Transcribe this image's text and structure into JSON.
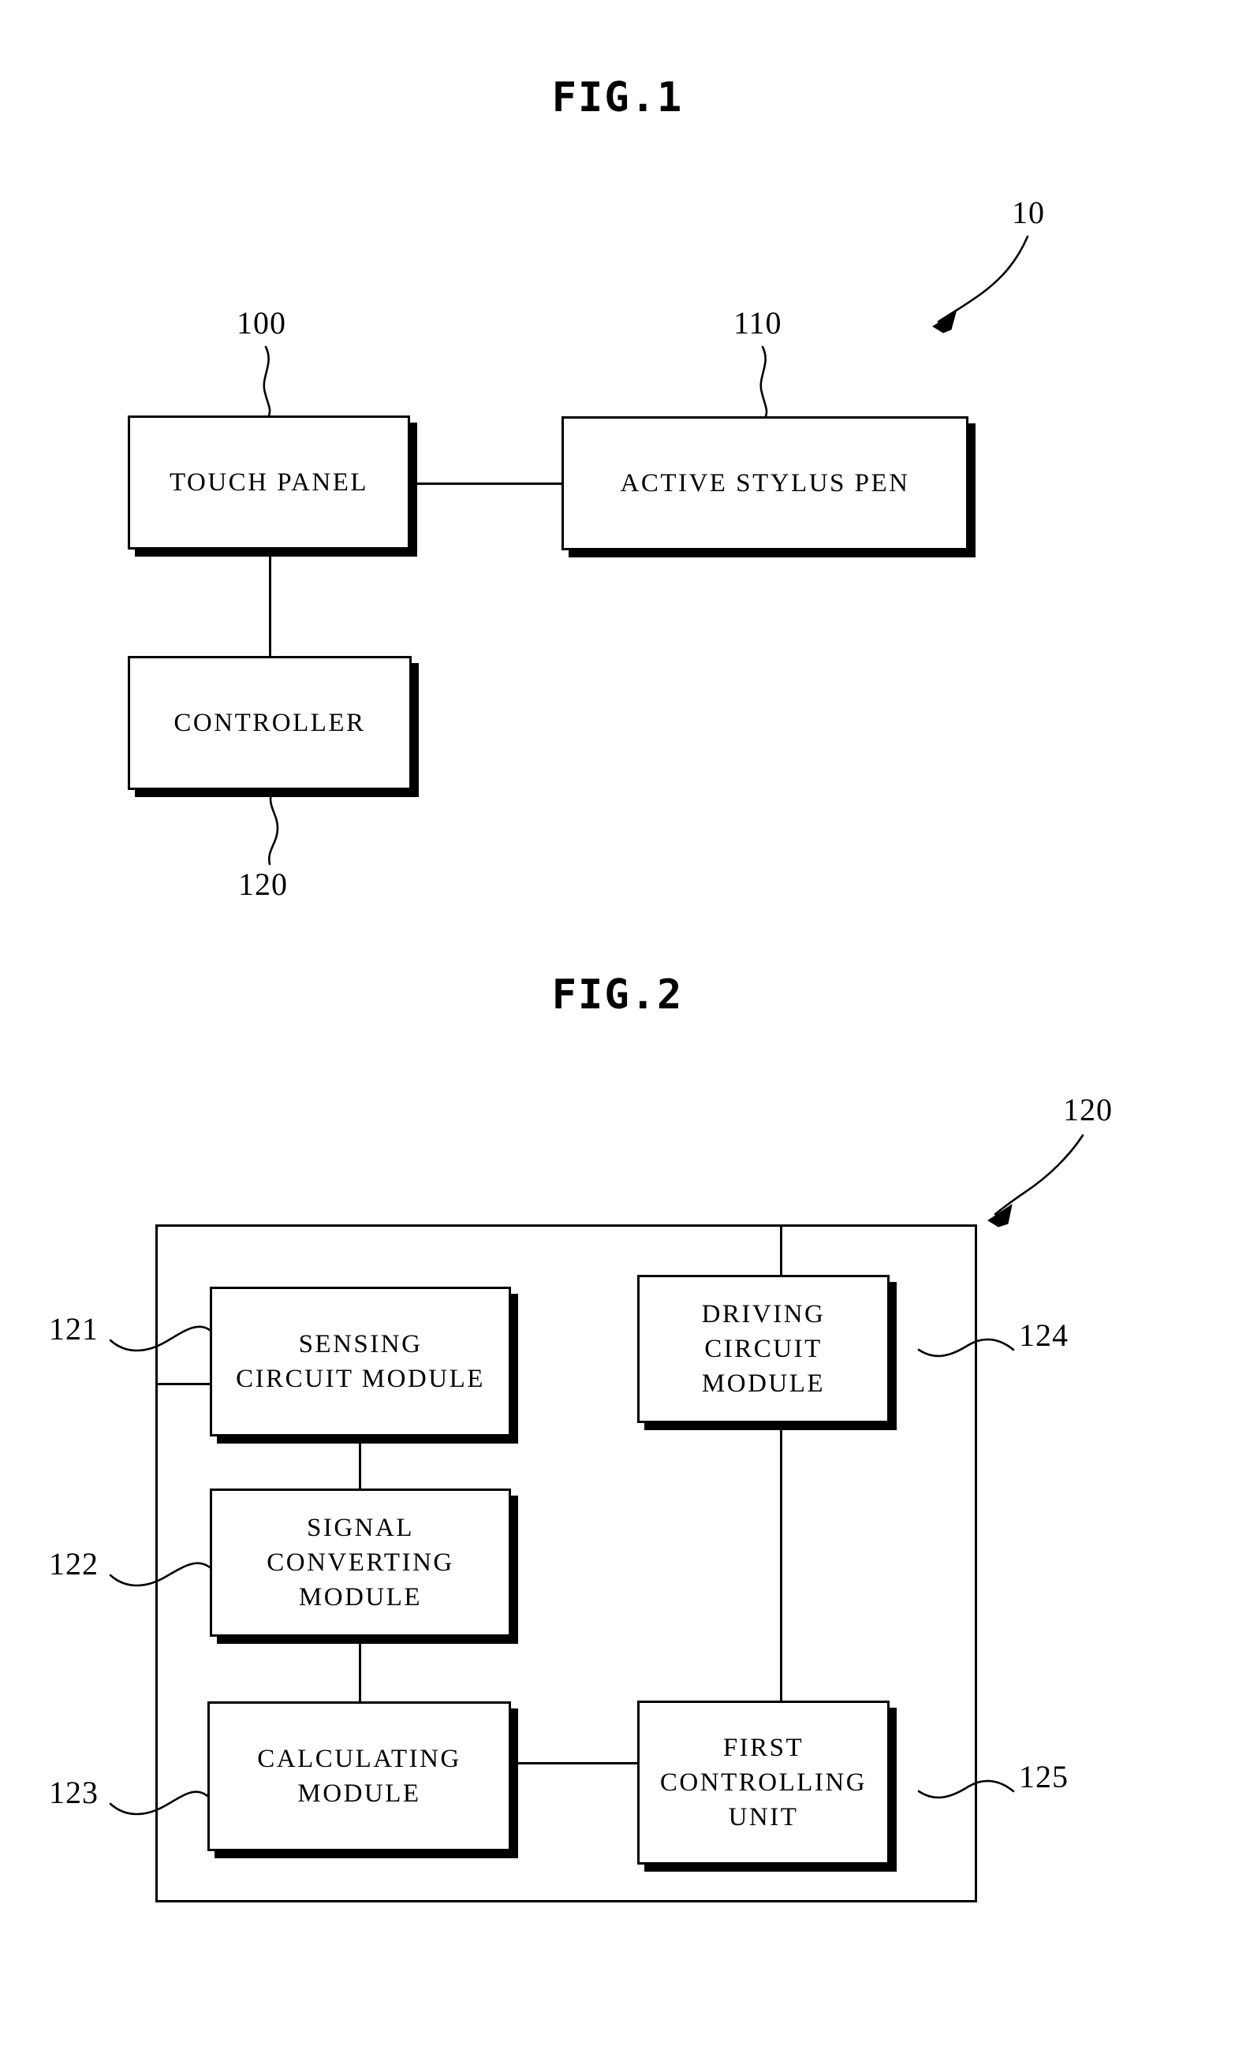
{
  "document": {
    "type": "patent-drawing-sheet",
    "figures": [
      {
        "id": "fig1",
        "title": "FIG.1",
        "system_numeral": "10",
        "blocks": [
          {
            "key": "touch_panel",
            "label": "TOUCH PANEL",
            "numeral": "100"
          },
          {
            "key": "active_stylus_pen",
            "label": "ACTIVE STYLUS PEN",
            "numeral": "110"
          },
          {
            "key": "controller",
            "label": "CONTROLLER",
            "numeral": "120"
          }
        ]
      },
      {
        "id": "fig2",
        "title": "FIG.2",
        "system_numeral": "120",
        "blocks": [
          {
            "key": "sensing_circuit_module",
            "label": "SENSING\nCIRCUIT MODULE",
            "numeral": "121"
          },
          {
            "key": "signal_converting_module",
            "label": "SIGNAL\nCONVERTING\nMODULE",
            "numeral": "122"
          },
          {
            "key": "calculating_module",
            "label": "CALCULATING\nMODULE",
            "numeral": "123"
          },
          {
            "key": "driving_circuit_module",
            "label": "DRIVING\nCIRCUIT\nMODULE",
            "numeral": "124"
          },
          {
            "key": "first_controlling_unit",
            "label": "FIRST\nCONTROLLING\nUNIT",
            "numeral": "125"
          }
        ]
      }
    ]
  },
  "fig1": {
    "title": "FIG.1",
    "numeral_10": "10",
    "touch_panel": {
      "label": "TOUCH PANEL",
      "numeral": "100"
    },
    "active_stylus_pen": {
      "label": "ACTIVE STYLUS PEN",
      "numeral": "110"
    },
    "controller": {
      "label": "CONTROLLER",
      "numeral": "120"
    }
  },
  "fig2": {
    "title": "FIG.2",
    "numeral_120": "120",
    "sensing_circuit_module": {
      "label": "SENSING\nCIRCUIT MODULE",
      "numeral": "121"
    },
    "signal_converting_module": {
      "label": "SIGNAL\nCONVERTING\nMODULE",
      "numeral": "122"
    },
    "calculating_module": {
      "label": "CALCULATING\nMODULE",
      "numeral": "123"
    },
    "driving_circuit_module": {
      "label": "DRIVING\nCIRCUIT\nMODULE",
      "numeral": "124"
    },
    "first_controlling_unit": {
      "label": "FIRST\nCONTROLLING\nUNIT",
      "numeral": "125"
    }
  },
  "colors": {
    "ink": "#000000",
    "paper": "#ffffff"
  }
}
